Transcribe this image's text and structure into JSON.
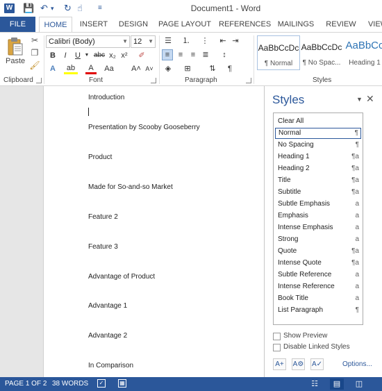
{
  "titlebar": {
    "app_logo": "W",
    "title": "Document1 - Word",
    "quick_access": {
      "save_icon": "💾",
      "undo_icon": "↶",
      "undo_arrow": "▾",
      "redo_icon": "↻",
      "touch_icon": "☝",
      "customize_icon": "≡"
    }
  },
  "tabs": [
    "FILE",
    "HOME",
    "INSERT",
    "DESIGN",
    "PAGE LAYOUT",
    "REFERENCES",
    "MAILINGS",
    "REVIEW",
    "VIEW"
  ],
  "ribbon": {
    "clipboard": {
      "label": "Clipboard",
      "paste": "Paste"
    },
    "font": {
      "label": "Font",
      "font_name": "Calibri (Body)",
      "font_size": "12",
      "bold": "B",
      "italic": "I",
      "underline": "U",
      "strikethrough": "abc",
      "subscript": "x₂",
      "superscript": "x²",
      "text_effects": "A",
      "highlight": "ab",
      "font_color": "A",
      "change_case": "Aa",
      "grow": "A˄",
      "shrink": "A˅"
    },
    "paragraph": {
      "label": "Paragraph",
      "show_marks": "¶"
    },
    "styles": {
      "label": "Styles",
      "gallery": [
        {
          "sample": "AaBbCcDc",
          "name": "¶ Normal"
        },
        {
          "sample": "AaBbCcDc",
          "name": "¶ No Spac..."
        },
        {
          "sample": "AaBbCc",
          "name": "Heading 1"
        }
      ]
    }
  },
  "document": {
    "paragraphs": [
      "Introduction",
      "Presentation by Scooby Gooseberry",
      "Product",
      "Made for So-and-so Market",
      "Feature 2",
      "Feature 3",
      "Advantage of Product",
      "Advantage 1",
      "Advantage 2",
      "In Comparison"
    ]
  },
  "styles_pane": {
    "title": "Styles",
    "items": [
      {
        "name": "Clear All",
        "glyph": ""
      },
      {
        "name": "Normal",
        "glyph": "¶"
      },
      {
        "name": "No Spacing",
        "glyph": "¶"
      },
      {
        "name": "Heading 1",
        "glyph": "¶a"
      },
      {
        "name": "Heading 2",
        "glyph": "¶a"
      },
      {
        "name": "Title",
        "glyph": "¶a"
      },
      {
        "name": "Subtitle",
        "glyph": "¶a"
      },
      {
        "name": "Subtle Emphasis",
        "glyph": "a"
      },
      {
        "name": "Emphasis",
        "glyph": "a"
      },
      {
        "name": "Intense Emphasis",
        "glyph": "a"
      },
      {
        "name": "Strong",
        "glyph": "a"
      },
      {
        "name": "Quote",
        "glyph": "¶a"
      },
      {
        "name": "Intense Quote",
        "glyph": "¶a"
      },
      {
        "name": "Subtle Reference",
        "glyph": "a"
      },
      {
        "name": "Intense Reference",
        "glyph": "a"
      },
      {
        "name": "Book Title",
        "glyph": "a"
      },
      {
        "name": "List Paragraph",
        "glyph": "¶"
      }
    ],
    "selected": "Normal",
    "show_preview": "Show Preview",
    "disable_linked": "Disable Linked Styles",
    "new_style_icon": "A+",
    "inspector_icon": "A⚙",
    "manage_icon": "A✓",
    "options": "Options..."
  },
  "statusbar": {
    "page": "PAGE 1 OF 2",
    "words": "38 WORDS",
    "proofing_icon": "✓",
    "macro_icon": "▦",
    "read_mode_icon": "☷",
    "print_layout_icon": "▤",
    "web_layout_icon": "◫"
  },
  "colors": {
    "accent": "#2b579a",
    "page": "#ffffff",
    "workspace": "#e6e6e6"
  }
}
